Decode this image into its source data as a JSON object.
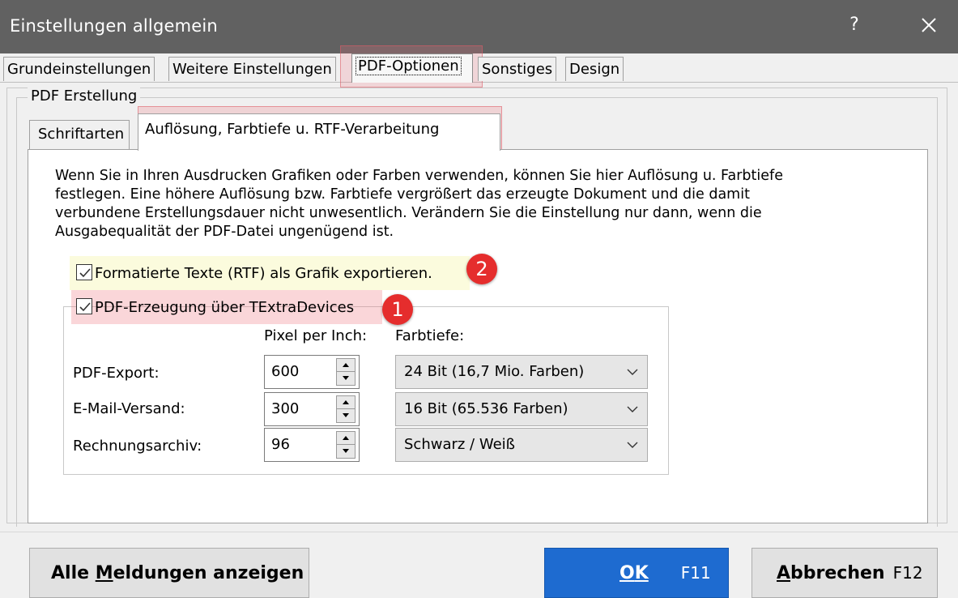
{
  "window": {
    "title": "Einstellungen allgemein",
    "help_glyph": "?",
    "title_bar_color": "#616161"
  },
  "tabs": [
    {
      "label": "Grundeinstellungen",
      "active": false
    },
    {
      "label": "Weitere Einstellungen",
      "active": false
    },
    {
      "label": "PDF-Optionen",
      "active": true
    },
    {
      "label": "Sonstiges",
      "active": false
    },
    {
      "label": "Design",
      "active": false
    }
  ],
  "group": {
    "label": "PDF Erstellung",
    "inner_tabs": [
      {
        "label": "Schriftarten",
        "active": false
      },
      {
        "label": "Auflösung, Farbtiefe u. RTF-Verarbeitung",
        "active": true
      }
    ]
  },
  "description": {
    "line1": "Wenn Sie in Ihren Ausdrucken Grafiken oder Farben verwenden, können Sie hier Auflösung u. Farbtiefe",
    "line2": "festlegen. Eine höhere Auflösung bzw. Farbtiefe vergrößert das erzeugte Dokument und die damit",
    "line3": "verbundene Erstellungsdauer nicht unwesentlich. Verändern Sie die Einstellung nur dann, wenn die",
    "line4": "Ausgabequalität der PDF-Datei ungenügend ist."
  },
  "checkboxes": {
    "rtf": {
      "label": "Formatierte Texte (RTF) als Grafik exportieren.",
      "checked": true
    },
    "pdf": {
      "label": "PDF-Erzeugung über TExtraDevices",
      "checked": true
    }
  },
  "annotations": {
    "badge_rtf": "2",
    "badge_pdf": "1",
    "color": "#e52d2d"
  },
  "table": {
    "header_ppi": "Pixel per Inch:",
    "header_farbtiefe": "Farbtiefe:",
    "rows": [
      {
        "label": "PDF-Export:",
        "ppi": "600",
        "farbtiefe": "24 Bit (16,7 Mio. Farben)"
      },
      {
        "label": "E-Mail-Versand:",
        "ppi": "300",
        "farbtiefe": "16 Bit (65.536 Farben)"
      },
      {
        "label": "Rechnungsarchiv:",
        "ppi": "96",
        "farbtiefe": "Schwarz / Weiß"
      }
    ]
  },
  "buttons": {
    "alle_pre": "Alle ",
    "alle_ul": "M",
    "alle_post": "eldungen anzeigen",
    "ok_ul": "O",
    "ok_post": "K",
    "ok_key": "F11",
    "abb_ul": "A",
    "abb_post": "bbrechen",
    "abb_key": "F12",
    "ok_color": "#1e6bd0"
  }
}
